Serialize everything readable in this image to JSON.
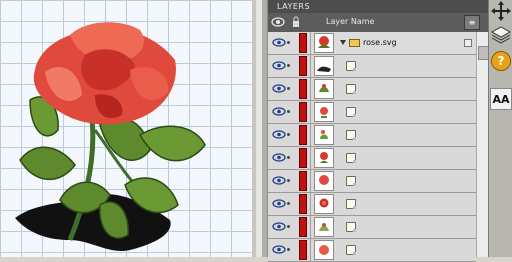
{
  "panel": {
    "title": "LAYERS",
    "column_name_label": "Layer Name",
    "menu_button_icon": "panel-menu-icon"
  },
  "group_layer": {
    "name": "rose.svg",
    "icon": "folder-icon",
    "swatch_color": "#c01010"
  },
  "layers": [
    {
      "thumb": "rose-part-1",
      "swatch_color": "#c01010"
    },
    {
      "thumb": "rose-part-2",
      "swatch_color": "#c01010"
    },
    {
      "thumb": "rose-part-3",
      "swatch_color": "#c01010"
    },
    {
      "thumb": "rose-part-4",
      "swatch_color": "#c01010"
    },
    {
      "thumb": "rose-part-5",
      "swatch_color": "#c01010"
    },
    {
      "thumb": "rose-part-6",
      "swatch_color": "#c01010"
    },
    {
      "thumb": "rose-part-7",
      "swatch_color": "#c01010"
    },
    {
      "thumb": "rose-part-8",
      "swatch_color": "#c01010"
    },
    {
      "thumb": "rose-part-9",
      "swatch_color": "#c01010"
    }
  ],
  "tools": [
    "move-icon",
    "layers-icon",
    "help-icon",
    "character-icon"
  ],
  "tool_labels": {
    "help": "?",
    "character": "AA"
  },
  "canvas_art": "rose-illustration"
}
